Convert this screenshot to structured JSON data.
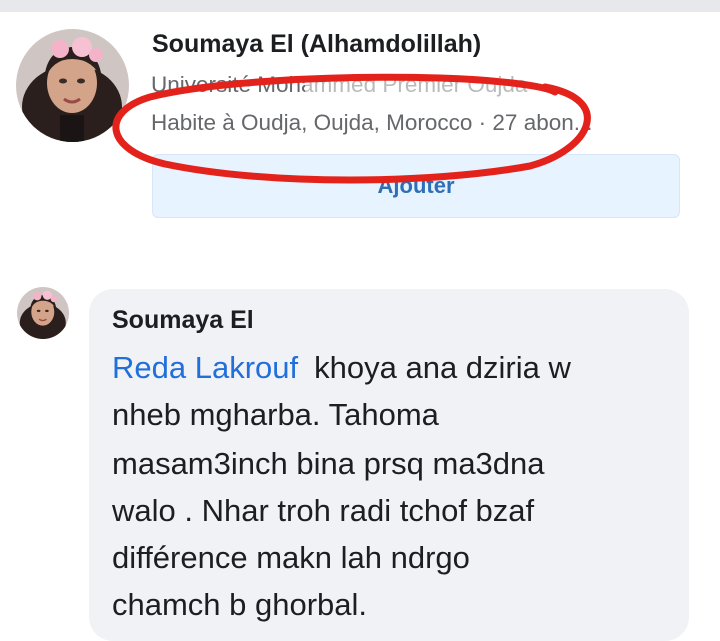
{
  "profile": {
    "name": "Soumaya El (Alhamdolillah)",
    "education": "Université Mohammed Premier Oujda ·",
    "location": "Habite à Oudja, Oujda, Morocco · 27 abon...",
    "add_button_label": "Ajouter"
  },
  "comment": {
    "author": "Soumaya El",
    "mention": "Reda Lakrouf",
    "line1_rest": "khoya ana dziria w",
    "line2": "nheb mgharba. Tahoma",
    "line3": "masam3inch bina prsq ma3dna",
    "line4": "walo . Nhar troh radi tchof bzaf",
    "line5": "différence makn lah ndrgo",
    "line6": "chamch b ghorbal."
  },
  "colors": {
    "annotation_circle": "#e3231b",
    "mention_link": "#216fdb",
    "button_bg": "#e7f3ff",
    "bubble_bg": "#f0f2f5"
  },
  "icons": {
    "profile_photo": "avatar-photo",
    "comment_photo": "avatar-photo"
  }
}
